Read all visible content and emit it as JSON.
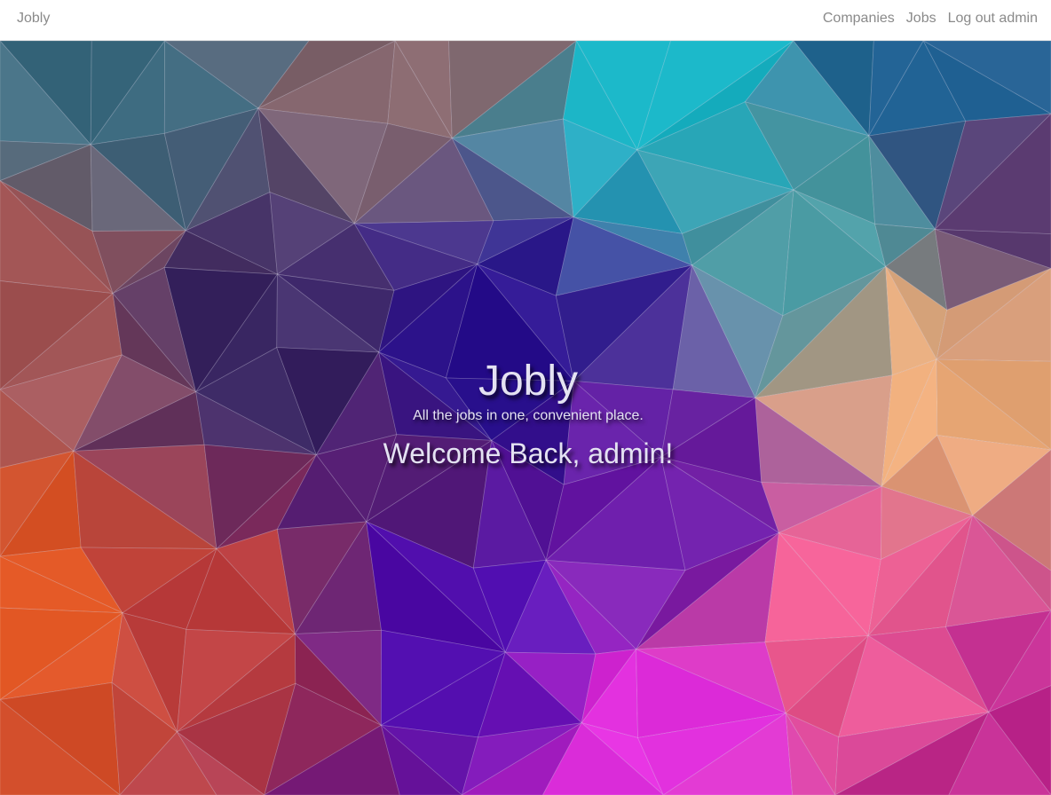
{
  "navbar": {
    "brand": "Jobly",
    "links": {
      "companies": "Companies",
      "jobs": "Jobs",
      "logout": "Log out admin"
    }
  },
  "hero": {
    "title": "Jobly",
    "tagline": "All the jobs in one, convenient place.",
    "welcome": "Welcome Back, admin!"
  },
  "background": {
    "palette": {
      "teal": "#1ab8c9",
      "slate": "#3f6e83",
      "indigo": "#2a118e",
      "violet": "#5310b5",
      "magenta": "#dc2ad8",
      "pink": "#ec5a8f",
      "orange": "#e85d2a",
      "peach": "#ecab78"
    }
  }
}
